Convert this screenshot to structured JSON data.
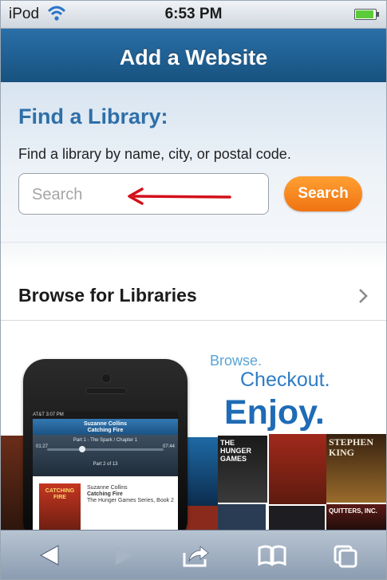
{
  "status_bar": {
    "carrier": "iPod",
    "time": "6:53 PM",
    "battery_level": 0.9
  },
  "title_bar": {
    "title": "Add a Website"
  },
  "find_library": {
    "heading": "Find a Library:",
    "description": "Find a library by name, city, or postal code.",
    "search_placeholder": "Search",
    "search_value": "",
    "search_button": "Search"
  },
  "browse": {
    "label": "Browse for Libraries"
  },
  "promo": {
    "line1": "Browse.",
    "line2": "Checkout.",
    "line3": "Enjoy.",
    "colors": {
      "accent": "#1f6bb5",
      "button": "#f28a1f"
    },
    "covers": [
      {
        "text": "THE HUNGER GAMES"
      },
      {
        "text": "STEPHEN KING"
      },
      {
        "text": "QUITTERS, INC."
      }
    ],
    "phone_screen": {
      "status": "AT&T  3:07 PM",
      "bar_title": "Suzanne Collins\nCatching Fire",
      "track": "Part 1 - The Spark / Chapter 1",
      "elapsed": "01:27",
      "remaining": "07:44",
      "part": "Part 2 of 13",
      "book_cover": "CATCHING FIRE",
      "book_author": "Suzanne Collins",
      "book_title": "Catching Fire",
      "book_series": "The Hunger Games Series, Book 2"
    }
  },
  "toolbar": {
    "buttons": [
      "back-icon",
      "forward-icon",
      "share-icon",
      "bookmarks-icon",
      "pages-icon"
    ]
  }
}
